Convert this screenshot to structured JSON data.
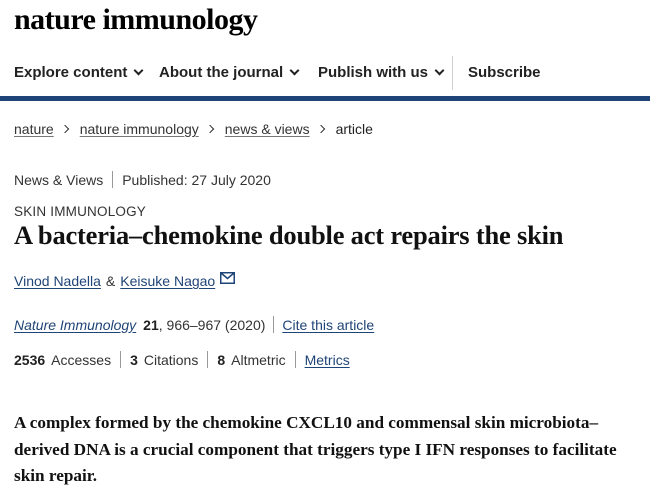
{
  "site": {
    "logo_text": "nature immunology"
  },
  "nav": {
    "items": [
      {
        "label": "Explore content"
      },
      {
        "label": "About the journal"
      },
      {
        "label": "Publish with us"
      }
    ],
    "subscribe_label": "Subscribe",
    "rule_color": "#1f4477"
  },
  "breadcrumb": {
    "items": [
      "nature",
      "nature immunology",
      "news & views"
    ],
    "current": "article"
  },
  "meta": {
    "article_type": "News & Views",
    "published": "Published: 27 July 2020"
  },
  "article": {
    "subject": "SKIN IMMUNOLOGY",
    "title": "A bacteria–chemokine double act repairs the skin",
    "authors": [
      "Vinod Nadella",
      "Keisuke Nagao"
    ],
    "author_separator": "&",
    "mail_icon": "mail-icon",
    "journal": "Nature Immunology",
    "volume": "21",
    "pages_year": ", 966–967 (2020)",
    "cite_label": "Cite this article",
    "standfirst": "A complex formed by the chemokine CXCL10 and commensal skin microbiota–derived DNA is a crucial component that triggers type I IFN responses to facilitate skin repair."
  },
  "metrics": {
    "accesses_count": "2536",
    "accesses_label": "Accesses",
    "citations_count": "3",
    "citations_label": "Citations",
    "altmetric_count": "8",
    "altmetric_label": "Altmetric",
    "metrics_link": "Metrics"
  },
  "colors": {
    "link": "#1f4477",
    "text": "#222222"
  }
}
